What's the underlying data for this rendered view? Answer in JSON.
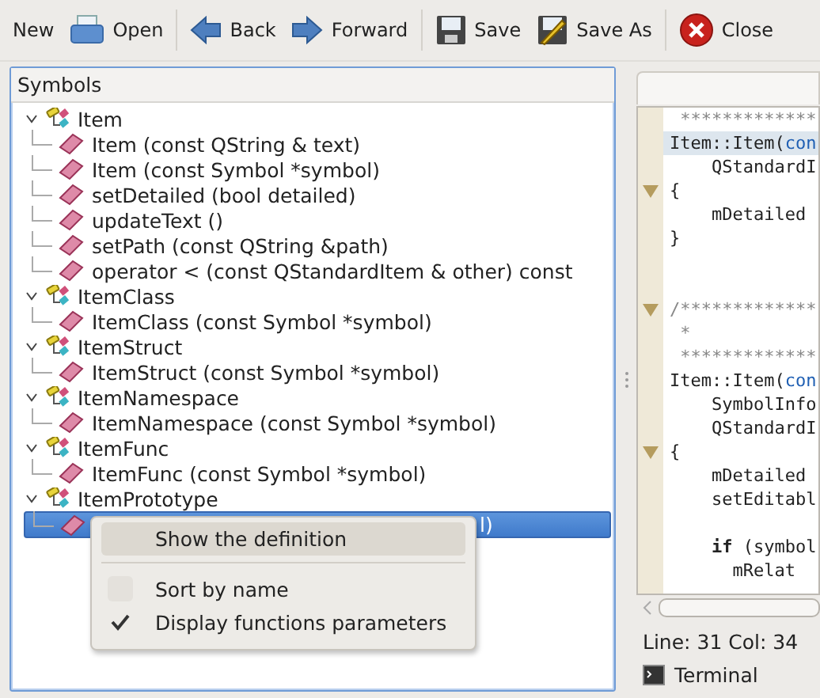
{
  "toolbar": [
    {
      "label": "New"
    },
    {
      "label": "Open"
    },
    {
      "label": "Back"
    },
    {
      "label": "Forward"
    },
    {
      "label": "Save"
    },
    {
      "label": "Save As"
    },
    {
      "label": "Close"
    }
  ],
  "symbols": {
    "title": "Symbols",
    "items": [
      {
        "label": "Item",
        "expanded": true,
        "children": [
          {
            "label": "Item (const QString & text)",
            "selected": false
          },
          {
            "label": "Item (const Symbol *symbol)",
            "selected": false
          },
          {
            "label": "setDetailed (bool detailed)",
            "selected": false
          },
          {
            "label": "updateText ()",
            "selected": false
          },
          {
            "label": "setPath (const QString &path)",
            "selected": false
          },
          {
            "label": "operator < (const QStandardItem & other) const",
            "selected": false
          }
        ]
      },
      {
        "label": "ItemClass",
        "expanded": true,
        "children": [
          {
            "label": "ItemClass (const Symbol *symbol)",
            "selected": false
          }
        ]
      },
      {
        "label": "ItemStruct",
        "expanded": true,
        "children": [
          {
            "label": "ItemStruct (const Symbol *symbol)",
            "selected": false
          }
        ]
      },
      {
        "label": "ItemNamespace",
        "expanded": true,
        "children": [
          {
            "label": "ItemNamespace (const Symbol *symbol)",
            "selected": false
          }
        ]
      },
      {
        "label": "ItemFunc",
        "expanded": true,
        "children": [
          {
            "label": "ItemFunc (const Symbol *symbol)",
            "selected": false
          }
        ]
      },
      {
        "label": "ItemPrototype",
        "expanded": true,
        "children": [
          {
            "label": "l)",
            "selected": true
          }
        ]
      }
    ]
  },
  "context_menu": [
    {
      "kind": "action",
      "label": "Show the definition",
      "selected": true
    },
    {
      "kind": "check",
      "label": "Sort by name",
      "checked": false
    },
    {
      "kind": "check",
      "label": "Display functions parameters",
      "checked": true
    }
  ],
  "editor": {
    "lines": [
      {
        "fold": false,
        "highlighted": false,
        "segments": [
          {
            "kind": "comment",
            "text": " *************"
          }
        ]
      },
      {
        "fold": false,
        "highlighted": true,
        "segments": [
          {
            "kind": "plain",
            "text": "Item::Item("
          },
          {
            "kind": "type",
            "text": "con"
          }
        ]
      },
      {
        "fold": false,
        "highlighted": false,
        "segments": [
          {
            "kind": "plain",
            "text": "    QStandardI"
          }
        ]
      },
      {
        "fold": true,
        "highlighted": false,
        "segments": [
          {
            "kind": "plain",
            "text": "{"
          }
        ]
      },
      {
        "fold": false,
        "highlighted": false,
        "segments": [
          {
            "kind": "plain",
            "text": "    mDetailed"
          }
        ]
      },
      {
        "fold": false,
        "highlighted": false,
        "segments": [
          {
            "kind": "plain",
            "text": "}"
          }
        ]
      },
      {
        "fold": false,
        "highlighted": false
      },
      {
        "fold": false,
        "highlighted": false
      },
      {
        "fold": true,
        "highlighted": false,
        "segments": [
          {
            "kind": "comment",
            "text": "/*************"
          }
        ]
      },
      {
        "fold": false,
        "highlighted": false,
        "segments": [
          {
            "kind": "comment",
            "text": " *"
          }
        ]
      },
      {
        "fold": false,
        "highlighted": false,
        "segments": [
          {
            "kind": "comment",
            "text": " *************"
          }
        ]
      },
      {
        "fold": false,
        "highlighted": false,
        "segments": [
          {
            "kind": "plain",
            "text": "Item::Item("
          },
          {
            "kind": "type",
            "text": "con"
          }
        ]
      },
      {
        "fold": false,
        "highlighted": false,
        "segments": [
          {
            "kind": "plain",
            "text": "    SymbolInfo"
          }
        ]
      },
      {
        "fold": false,
        "highlighted": false,
        "segments": [
          {
            "kind": "plain",
            "text": "    QStandardI"
          }
        ]
      },
      {
        "fold": true,
        "highlighted": false,
        "segments": [
          {
            "kind": "plain",
            "text": "{"
          }
        ]
      },
      {
        "fold": false,
        "highlighted": false,
        "segments": [
          {
            "kind": "plain",
            "text": "    mDetailed"
          }
        ]
      },
      {
        "fold": false,
        "highlighted": false,
        "segments": [
          {
            "kind": "plain",
            "text": "    setEditabl"
          }
        ]
      },
      {
        "fold": false,
        "highlighted": false
      },
      {
        "fold": false,
        "highlighted": false,
        "segments": [
          {
            "kind": "keyword",
            "text": "    if"
          },
          {
            "kind": "plain",
            "text": " (symbol"
          }
        ]
      },
      {
        "fold": false,
        "highlighted": false,
        "segments": [
          {
            "kind": "plain",
            "text": "      mRelat"
          }
        ]
      }
    ]
  },
  "status": "Line: 31 Col: 34",
  "terminal": {
    "label": "Terminal"
  }
}
